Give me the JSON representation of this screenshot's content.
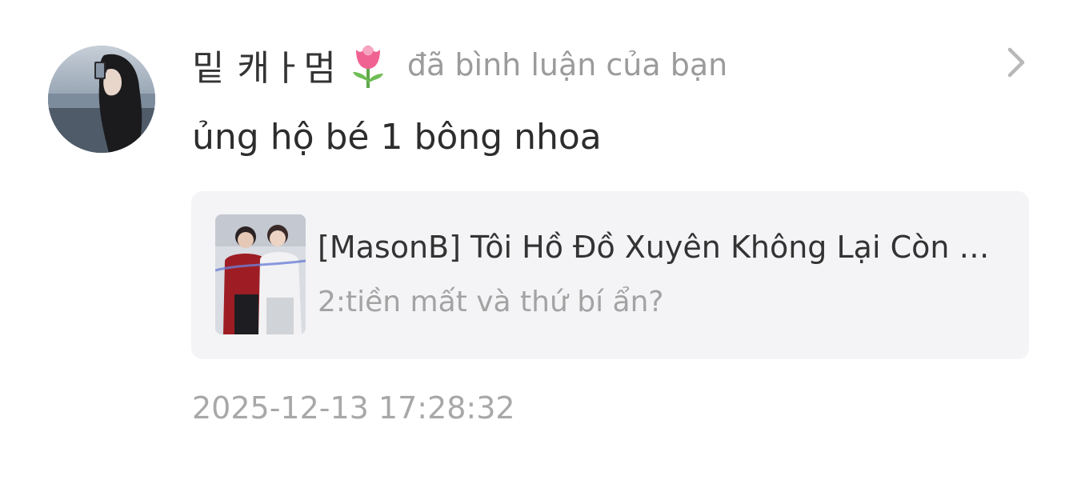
{
  "notification": {
    "username": "밑 캐ㅏ멈",
    "username_emoji_icon": "tulip-icon",
    "action_text": "đã bình luận của bạn",
    "comment": "ủng hộ bé 1 bông nhoa",
    "story": {
      "title": "[MasonB] Tôi Hồ Đồ Xuyên Không Lại Còn Được Công Ngoan",
      "chapter": "2:tiền mất và thứ bí ẩn?"
    },
    "timestamp": "2025-12-13 17:28:32"
  },
  "colors": {
    "username": "#333333",
    "secondary_text": "#9b9b9b",
    "card_background": "#f4f4f6",
    "tulip": "#f06292"
  }
}
